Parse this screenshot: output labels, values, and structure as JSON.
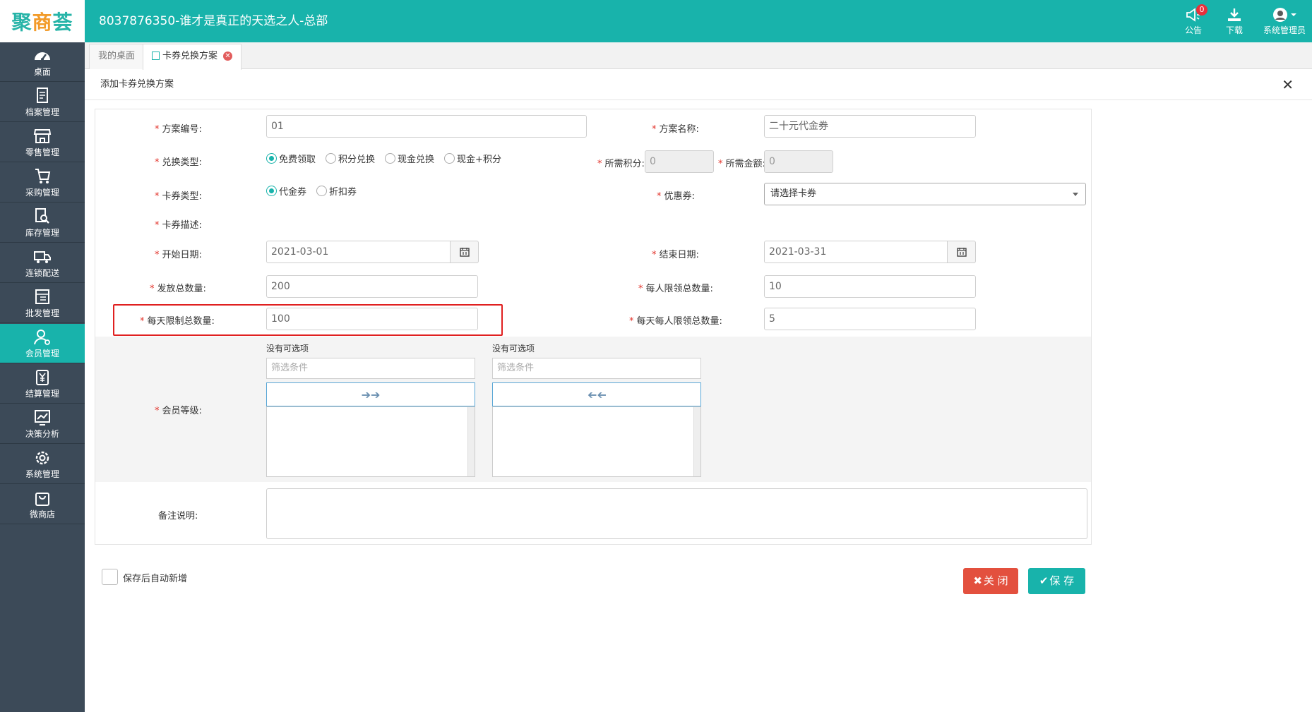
{
  "app": {
    "logo_part1": "聚",
    "logo_part2": "商",
    "logo_part3": "荟",
    "company_title": "8037876350-谁才是真正的天选之人-总部",
    "notice_label": "公告",
    "notice_count": "0",
    "download_label": "下载",
    "user_label": "系统管理员",
    "brand_color": "#18b3ab"
  },
  "sidebar": {
    "items": [
      {
        "label": "桌面",
        "icon": "dashboard-icon"
      },
      {
        "label": "档案管理",
        "icon": "file-icon"
      },
      {
        "label": "零售管理",
        "icon": "store-icon"
      },
      {
        "label": "采购管理",
        "icon": "cart-icon"
      },
      {
        "label": "库存管理",
        "icon": "inventory-search-icon"
      },
      {
        "label": "连锁配送",
        "icon": "truck-icon"
      },
      {
        "label": "批发管理",
        "icon": "wholesale-icon"
      },
      {
        "label": "会员管理",
        "icon": "member-icon"
      },
      {
        "label": "结算管理",
        "icon": "yen-icon"
      },
      {
        "label": "决策分析",
        "icon": "chart-icon"
      },
      {
        "label": "系统管理",
        "icon": "gear-icon"
      },
      {
        "label": "微商店",
        "icon": "shopping-bag-icon"
      }
    ],
    "active": "会员管理"
  },
  "tabs": [
    {
      "label": "我的桌面",
      "active": false
    },
    {
      "label": "卡券兑换方案",
      "active": true
    }
  ],
  "panel": {
    "title": "添加卡券兑换方案"
  },
  "form": {
    "scheme_no": {
      "label": "方案编号:",
      "value": "01"
    },
    "scheme_name": {
      "label": "方案名称:",
      "value": "二十元代金券"
    },
    "exchange_type": {
      "label": "兑换类型:",
      "options": [
        "免费领取",
        "积分兑换",
        "现金兑换",
        "现金+积分"
      ],
      "selected": "免费领取"
    },
    "points_needed": {
      "label": "所需积分:",
      "value": "0"
    },
    "amount_needed": {
      "label": "所需金额:",
      "value": "0"
    },
    "card_type": {
      "label": "卡券类型:",
      "options": [
        "代金券",
        "折扣券"
      ],
      "selected": "代金券"
    },
    "coupon": {
      "label": "优惠券:",
      "value": "请选择卡券"
    },
    "card_desc": {
      "label": "卡券描述:"
    },
    "start_date": {
      "label": "开始日期:",
      "value": "2021-03-01"
    },
    "end_date": {
      "label": "结束日期:",
      "value": "2021-03-31"
    },
    "total_issue": {
      "label": "发放总数量:",
      "value": "200"
    },
    "per_person_limit": {
      "label": "每人限领总数量:",
      "value": "10"
    },
    "daily_limit": {
      "label": "每天限制总数量:",
      "value": "100"
    },
    "daily_per_person_limit": {
      "label": "每天每人限领总数量:",
      "value": "5"
    },
    "member_level": {
      "label": "会员等级:",
      "left_title": "没有可选项",
      "right_title": "没有可选项",
      "left_filter_placeholder": "筛选条件",
      "right_filter_placeholder": "筛选条件"
    },
    "remark": {
      "label": "备注说明:",
      "value": ""
    },
    "required_mark": "*"
  },
  "footer": {
    "auto_add_label": "保存后自动新增",
    "close_label": "关 闭",
    "save_label": "保 存"
  }
}
